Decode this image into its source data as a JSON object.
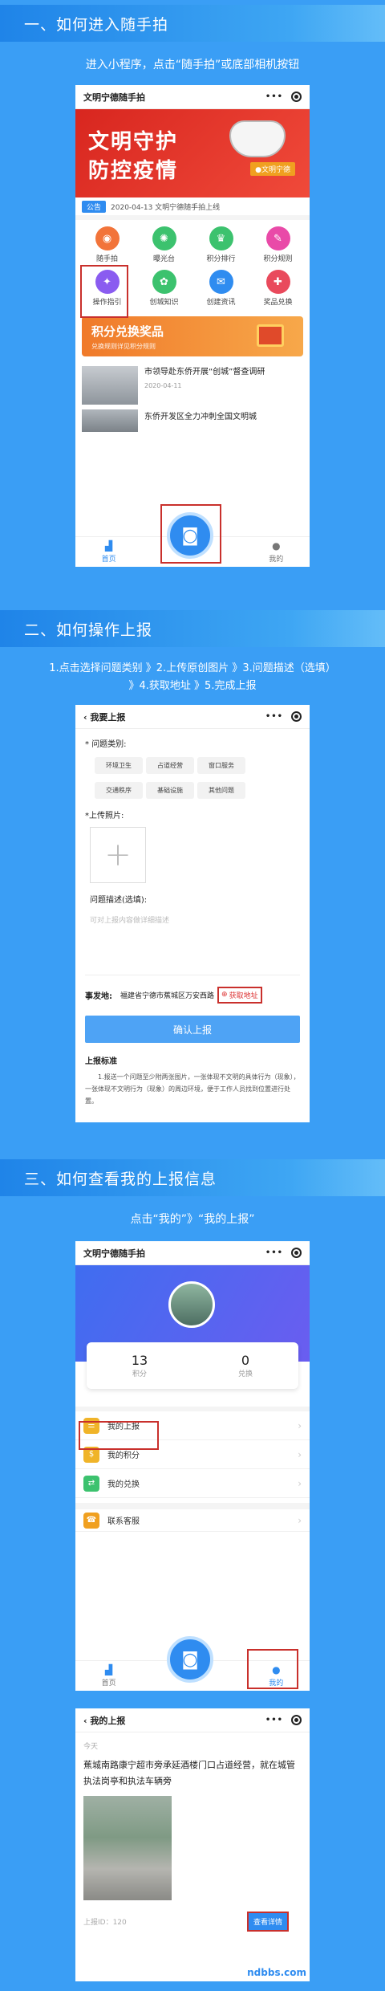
{
  "section1": {
    "header": "一、如何进入随手拍",
    "caption": "进入小程序，点击“随手拍”或底部相机按钮",
    "app_title": "文明宁德随手拍",
    "banner_line1": "文明守护",
    "banner_line2": "防控疫情",
    "banner_badge": "●文明宁德",
    "notice_tag": "公告",
    "notice_text": "2020-04-13  文明宁德随手拍上线",
    "grid": [
      {
        "label": "随手拍",
        "icon": "camera-icon",
        "color": "#f2743a",
        "glyph": "◉"
      },
      {
        "label": "曝光台",
        "icon": "aperture-icon",
        "color": "#3cc26e",
        "glyph": "✺"
      },
      {
        "label": "积分排行",
        "icon": "medal-icon",
        "color": "#3cc26e",
        "glyph": "♛"
      },
      {
        "label": "积分规则",
        "icon": "rules-icon",
        "color": "#e94aa8",
        "glyph": "✎"
      },
      {
        "label": "操作指引",
        "icon": "guide-icon",
        "color": "#8a5cf0",
        "glyph": "✦"
      },
      {
        "label": "创城知识",
        "icon": "knowledge-icon",
        "color": "#3cc26e",
        "glyph": "✿"
      },
      {
        "label": "创建资讯",
        "icon": "news-icon",
        "color": "#2f8cf0",
        "glyph": "✉"
      },
      {
        "label": "奖品兑换",
        "icon": "gift-icon",
        "color": "#e94a5c",
        "glyph": "✚"
      }
    ],
    "promo_title": "积分兑换奖品",
    "promo_sub": "兑换规则详见积分规则",
    "news1_title": "市领导赴东侨开展“创城”督查调研",
    "news1_date": "2020-04-11",
    "news2_title": "东侨开发区全力冲刺全国文明城",
    "tab_home": "首页",
    "tab_mine": "我的"
  },
  "section2": {
    "header": "二、如何操作上报",
    "caption_line1": "1.点击选择问题类别 》2.上传原创图片 》3.问题描述（选填）",
    "caption_line2": "》4.获取地址 》5.完成上报",
    "page_title": "我要上报",
    "category_label": "* 问题类别:",
    "categories": [
      "环境卫生",
      "占道经营",
      "窗口服务",
      "交通秩序",
      "基础设施",
      "其他问题"
    ],
    "upload_label": "*上传照片:",
    "desc_label": "问题描述(选填):",
    "desc_placeholder": "可对上报内容做详细描述",
    "addr_label": "事发地:",
    "addr_value": "福建省宁德市蕉城区万安西路",
    "get_addr": "获取地址",
    "confirm": "确认上报",
    "standard_title": "上报标准",
    "standard_text": "1.报送一个问题至少附两张图片，一张体现不文明的具体行为（现象），一张体现不文明行为（现象）的周边环境，便于工作人员找到位置进行处置。"
  },
  "section3": {
    "header": "三、如何查看我的上报信息",
    "caption": "点击“我的”》“我的上报”",
    "app_title": "文明宁德随手拍",
    "points_value": "13",
    "points_label": "积分",
    "exchange_value": "0",
    "exchange_label": "兑换",
    "menu": [
      {
        "label": "我的上报",
        "icon": "report-icon",
        "color": "#f0b429",
        "glyph": "☰"
      },
      {
        "label": "我的积分",
        "icon": "points-icon",
        "color": "#f0b429",
        "glyph": "$"
      },
      {
        "label": "我的兑换",
        "icon": "exchange-icon",
        "color": "#3cc26e",
        "glyph": "⇄"
      }
    ],
    "service": {
      "label": "联系客服",
      "icon": "service-icon",
      "color": "#f0a020",
      "glyph": "☎"
    },
    "tab_home": "首页",
    "tab_mine": "我的",
    "detail_title": "我的上报",
    "today": "今天",
    "report_text": "蕉城南路康宁超市旁承延酒楼门口占道经营，就在城管执法岗亭和执法车辆旁",
    "report_id": "上报ID：120",
    "view_detail": "查看详情",
    "watermark": "ndbbs.com"
  }
}
